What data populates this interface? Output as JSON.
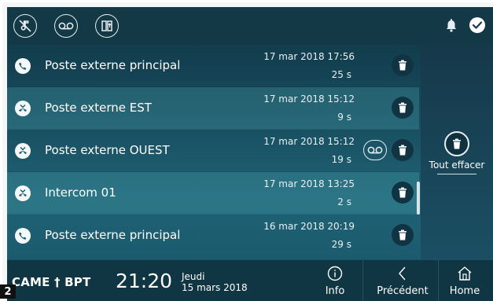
{
  "topbar": {
    "icons": [
      "mute-ringtone-icon",
      "voicemail-icon",
      "door-open-icon"
    ],
    "right_icons": [
      "bell-icon",
      "check-icon"
    ]
  },
  "calls": [
    {
      "name": "Poste externe principal",
      "date": "17 mar 2018 17:56",
      "duration": "25 s",
      "type": "answered-call-icon",
      "voicemail": false
    },
    {
      "name": "Poste externe EST",
      "date": "17 mar 2018 15:12",
      "duration": "9 s",
      "type": "missed-call-icon",
      "voicemail": false
    },
    {
      "name": "Poste externe OUEST",
      "date": "17 mar 2018 15:12",
      "duration": "19 s",
      "type": "missed-call-icon",
      "voicemail": true
    },
    {
      "name": "Intercom 01",
      "date": "17 mar 2018 13:25",
      "duration": "2 s",
      "type": "missed-call-icon",
      "voicemail": false
    },
    {
      "name": "Poste externe principal",
      "date": "16 mar 2018 20:19",
      "duration": "29 s",
      "type": "answered-call-icon",
      "voicemail": false
    }
  ],
  "clear_all": {
    "label": "Tout effacer"
  },
  "bottombar": {
    "brand": "CAME † BPT",
    "time": "21:20",
    "day": "Jeudi",
    "date": "15 mars 2018",
    "nav": {
      "info": "Info",
      "previous": "Précédent",
      "home": "Home"
    }
  },
  "badge": "2",
  "colors": {
    "background_top": "#0f3442",
    "background_bottom": "#1a566a",
    "row_highlight": "#3d8c98",
    "trash_button": "#113443"
  }
}
